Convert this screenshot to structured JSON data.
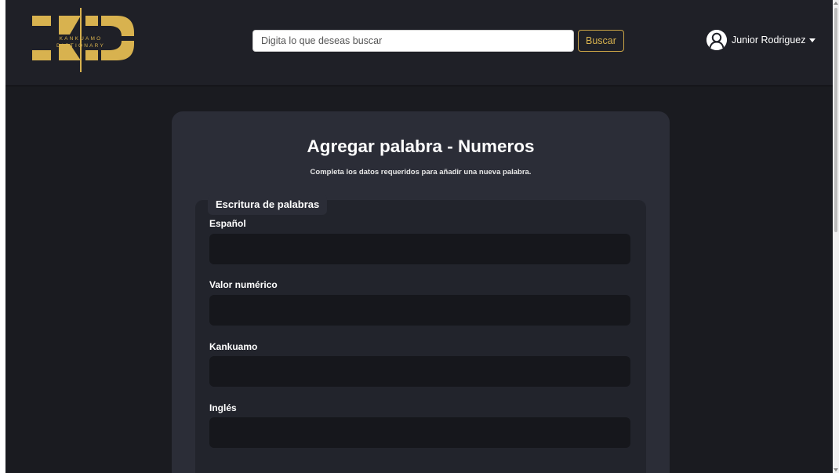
{
  "brand": {
    "logo_letters": "KD",
    "logo_line1": "KANKUAMO",
    "logo_line2": "DICTIONARY",
    "gold": "#d8b24f"
  },
  "search": {
    "placeholder": "Digita lo que deseas buscar",
    "button_label": "Buscar"
  },
  "user": {
    "name": "Junior Rodriguez"
  },
  "form": {
    "title": "Agregar palabra - Numeros",
    "subtitle": "Completa los datos requeridos para añadir una nueva palabra.",
    "section_legend": "Escritura de palabras",
    "fields": [
      {
        "label": "Español",
        "value": ""
      },
      {
        "label": "Valor numérico",
        "value": ""
      },
      {
        "label": "Kankuamo",
        "value": ""
      },
      {
        "label": "Inglés",
        "value": ""
      }
    ]
  }
}
